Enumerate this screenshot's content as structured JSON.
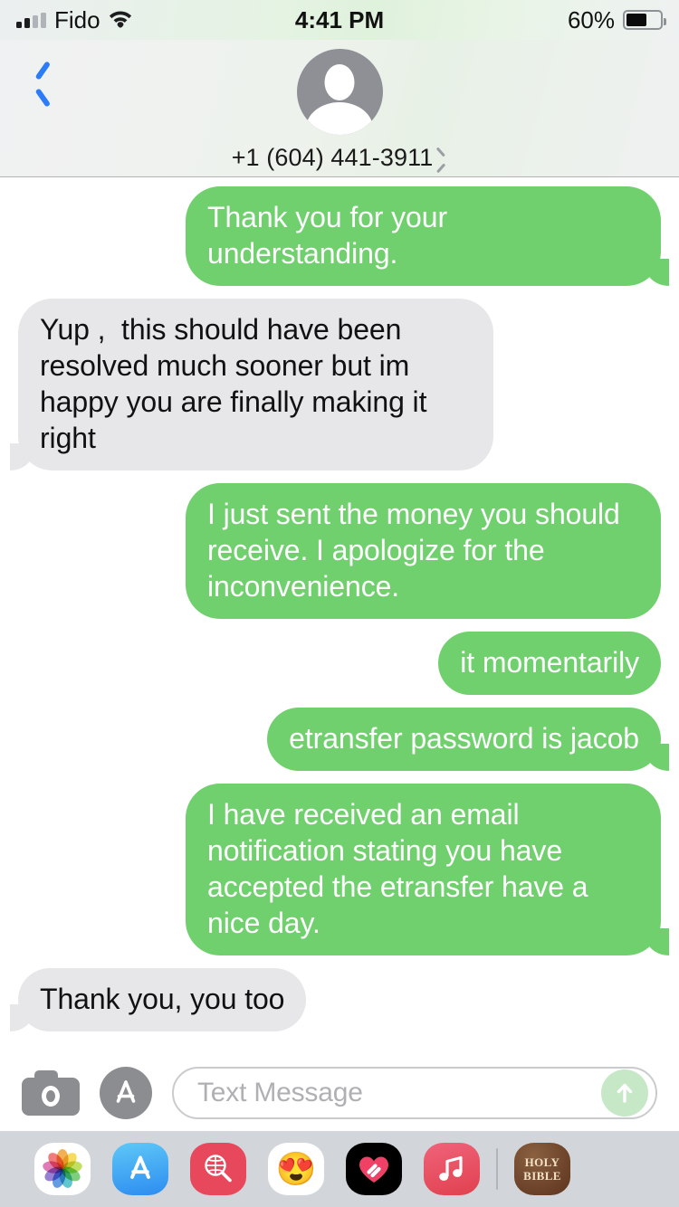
{
  "status_bar": {
    "carrier": "Fido",
    "time": "4:41 PM",
    "battery_percent": "60%",
    "battery_level": 60,
    "signal_bars_filled": 2,
    "signal_bars_total": 4,
    "wifi_icon": "wifi-icon"
  },
  "header": {
    "back_icon": "chevron-left-icon",
    "avatar_icon": "person-placeholder-avatar",
    "contact_name": "+1 (604) 441-3911",
    "detail_chevron_icon": "chevron-right-icon"
  },
  "colors": {
    "outgoing_bubble": "#6fd06d",
    "incoming_bubble": "#e7e7e9",
    "outgoing_text": "#ffffff",
    "incoming_text": "#111113",
    "back_button": "#2b7cf6",
    "send_button": "#c6e8c7",
    "drawer_background": "#d2d6da"
  },
  "messages": [
    {
      "id": 1,
      "direction": "outgoing",
      "text": "Thank you for your understanding.",
      "has_tail": true
    },
    {
      "id": 2,
      "direction": "incoming",
      "text": "Yup ,  this should have been resolved much sooner but im happy you are finally making it right",
      "has_tail": true
    },
    {
      "id": 3,
      "direction": "outgoing",
      "text": "I just sent the money you should receive. I apologize for the inconvenience.",
      "has_tail": false
    },
    {
      "id": 4,
      "direction": "outgoing",
      "text": "it momentarily",
      "has_tail": false
    },
    {
      "id": 5,
      "direction": "outgoing",
      "text": "etransfer password is jacob",
      "has_tail": true
    },
    {
      "id": 6,
      "direction": "outgoing",
      "text": "I have received an email notification stating you have accepted the etransfer have a nice day.",
      "has_tail": true
    },
    {
      "id": 7,
      "direction": "incoming",
      "text": "Thank you, you too",
      "has_tail": true
    }
  ],
  "input_bar": {
    "camera_icon": "camera-icon",
    "app_store_icon": "app-store-icon",
    "placeholder": "Text Message",
    "value": "",
    "send_icon": "arrow-up-icon"
  },
  "app_drawer": {
    "apps": [
      {
        "name": "photos-app",
        "label": "Photos",
        "text": ""
      },
      {
        "name": "app-store-app",
        "label": "App Store",
        "text": ""
      },
      {
        "name": "images-search-app",
        "label": "#images",
        "text": ""
      },
      {
        "name": "memoji-app",
        "label": "Memoji Stickers",
        "text": "😍"
      },
      {
        "name": "apple-music-love-app",
        "label": "Apple Music Love",
        "text": ""
      },
      {
        "name": "apple-music-app",
        "label": "Apple Music",
        "text": ""
      },
      {
        "name": "holy-bible-app",
        "label": "Holy Bible",
        "line1": "HOLY",
        "line2": "BIBLE"
      }
    ]
  }
}
